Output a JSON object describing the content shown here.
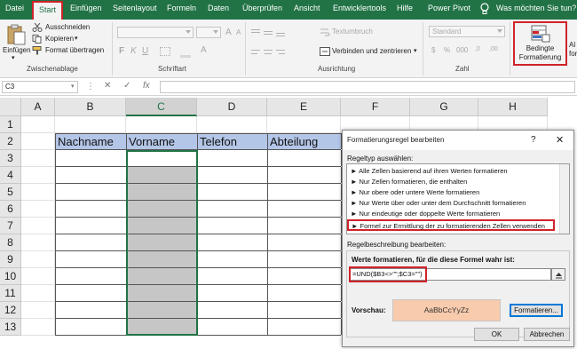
{
  "ribbon": {
    "tabs": [
      "Datei",
      "Start",
      "Einfügen",
      "Seitenlayout",
      "Formeln",
      "Daten",
      "Überprüfen",
      "Ansicht",
      "Entwicklertools",
      "Hilfe",
      "Power Pivot"
    ],
    "active_tab": "Start",
    "tell_me": "Was möchten Sie tun?",
    "clipboard": {
      "paste_label": "Einfügen",
      "cut_label": "Ausschneiden",
      "copy_label": "Kopieren",
      "format_painter_label": "Format übertragen",
      "group_label": "Zwischenablage"
    },
    "font": {
      "group_label": "Schriftart"
    },
    "alignment": {
      "wrap_label": "Textumbruch",
      "merge_label": "Verbinden und zentrieren",
      "group_label": "Ausrichtung"
    },
    "number": {
      "format_value": "Standard",
      "group_label": "Zahl"
    },
    "styles": {
      "cond_format_line1": "Bedingte",
      "cond_format_line2": "Formatierung",
      "next_label_fragment": "Al",
      "next_label_fragment2": "for"
    }
  },
  "formula_bar": {
    "name_box": "C3",
    "fx_label": "fx",
    "value": ""
  },
  "sheet": {
    "columns": [
      "A",
      "B",
      "C",
      "D",
      "E",
      "F",
      "G",
      "H"
    ],
    "selected_column": "C",
    "rows": [
      "1",
      "2",
      "3",
      "4",
      "5",
      "6",
      "7",
      "8",
      "9",
      "10",
      "11",
      "12",
      "13"
    ],
    "table_headers": [
      "Nachname",
      "Vorname",
      "Telefon",
      "Abteilung"
    ]
  },
  "dialog": {
    "title": "Formatierungsregel bearbeiten",
    "help_glyph": "?",
    "close_glyph": "✕",
    "rule_type_label": "Regeltyp auswählen:",
    "rule_types": [
      "► Alle Zellen basierend auf ihren Werten formatieren",
      "► Nur Zellen formatieren, die enthalten",
      "► Nur obere oder untere Werte formatieren",
      "► Nur Werte über oder unter dem Durchschnitt formatieren",
      "► Nur eindeutige oder doppelte Werte formatieren",
      "► Formel zur Ermittlung der zu formatierenden Zellen verwenden"
    ],
    "selected_rule_index": 5,
    "desc_label": "Regelbeschreibung bearbeiten:",
    "formula_label": "Werte formatieren, für die diese Formel wahr ist:",
    "formula_value": "=UND($B3<>\"\";$C3=\"\")",
    "preview_label": "Vorschau:",
    "preview_sample": "AaBbCcYyZz",
    "format_button": "Formatieren...",
    "ok_button": "OK",
    "cancel_button": "Abbrechen"
  },
  "colors": {
    "excel_green": "#217346",
    "highlight_red": "#d0232a",
    "header_fill": "#b4c6e7",
    "empty_fill": "#c6c6c6",
    "preview_fill": "#f8cbad"
  }
}
